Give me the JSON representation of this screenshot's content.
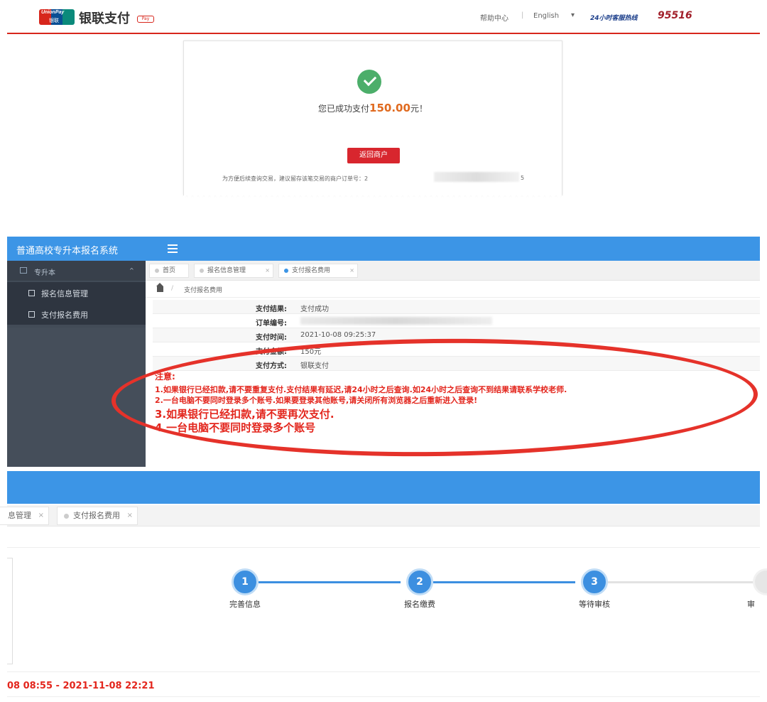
{
  "unionpay": {
    "brand": "银联支付",
    "brand_tag": "Pay",
    "logo_text": "UnionPay",
    "logo_text_cn": "银联",
    "nav_help": "帮助中心",
    "nav_separator": "|",
    "nav_language": "English",
    "language_caret": "▾",
    "hotline_label": "24小时客服热线",
    "hotline": "95516",
    "accent_color": "#d7261c"
  },
  "success": {
    "prefix": "您已成功支付",
    "amount": "150.00",
    "suffix": "元！",
    "return_button": "返回商户",
    "order_tip": "为方便后续查询交易，建议留存该笔交易的商户订单号：2",
    "order_tail": "5",
    "check_color": "#4cae6a"
  },
  "system": {
    "title": "普通高校专升本报名系统",
    "header_color": "#3c95e6",
    "sidebar": {
      "group": "专升本",
      "group_caret": "^",
      "items": [
        {
          "label": "报名信息管理"
        },
        {
          "label": "支付报名费用"
        }
      ]
    },
    "tabs": [
      {
        "label": "首页",
        "close": ""
      },
      {
        "label": "报名信息管理",
        "close": "×"
      },
      {
        "label": "支付报名费用",
        "close": "×"
      }
    ],
    "breadcrumb_separator": "/",
    "breadcrumb": "支付报名费用",
    "info": [
      {
        "label": "支付结果:",
        "value": "支付成功"
      },
      {
        "label": "订单编号:",
        "value": ""
      },
      {
        "label": "支付时间:",
        "value": "2021-10-08 09:25:37"
      },
      {
        "label": "支付金额:",
        "value": "150元"
      },
      {
        "label": "支付方式:",
        "value": "银联支付"
      }
    ],
    "notices": [
      "注意:",
      "1.如果银行已经扣款,请不要重复支付.支付结果有延迟,请24小时之后查询.如24小时之后查询不到结果请联系学校老师.",
      "2.一台电脑不要同时登录多个账号.如果要登录其他账号,请关闭所有浏览器之后重新进入登录!",
      "3.如果银行已经扣款,请不要再次支付.",
      "4.一台电脑不要同时登录多个账号"
    ],
    "notice_color": "#e3261d"
  },
  "steps_view": {
    "tabs": [
      {
        "label": "息管理",
        "close": "×"
      },
      {
        "label": "支付报名费用",
        "close": "×"
      }
    ],
    "steps": [
      {
        "num": "1",
        "label": "完善信息"
      },
      {
        "num": "2",
        "label": "报名缴费"
      },
      {
        "num": "3",
        "label": "等待审核"
      },
      {
        "num": "",
        "label": "审"
      }
    ],
    "time_range": "08 08:55 - 2021-11-08 22:21"
  }
}
